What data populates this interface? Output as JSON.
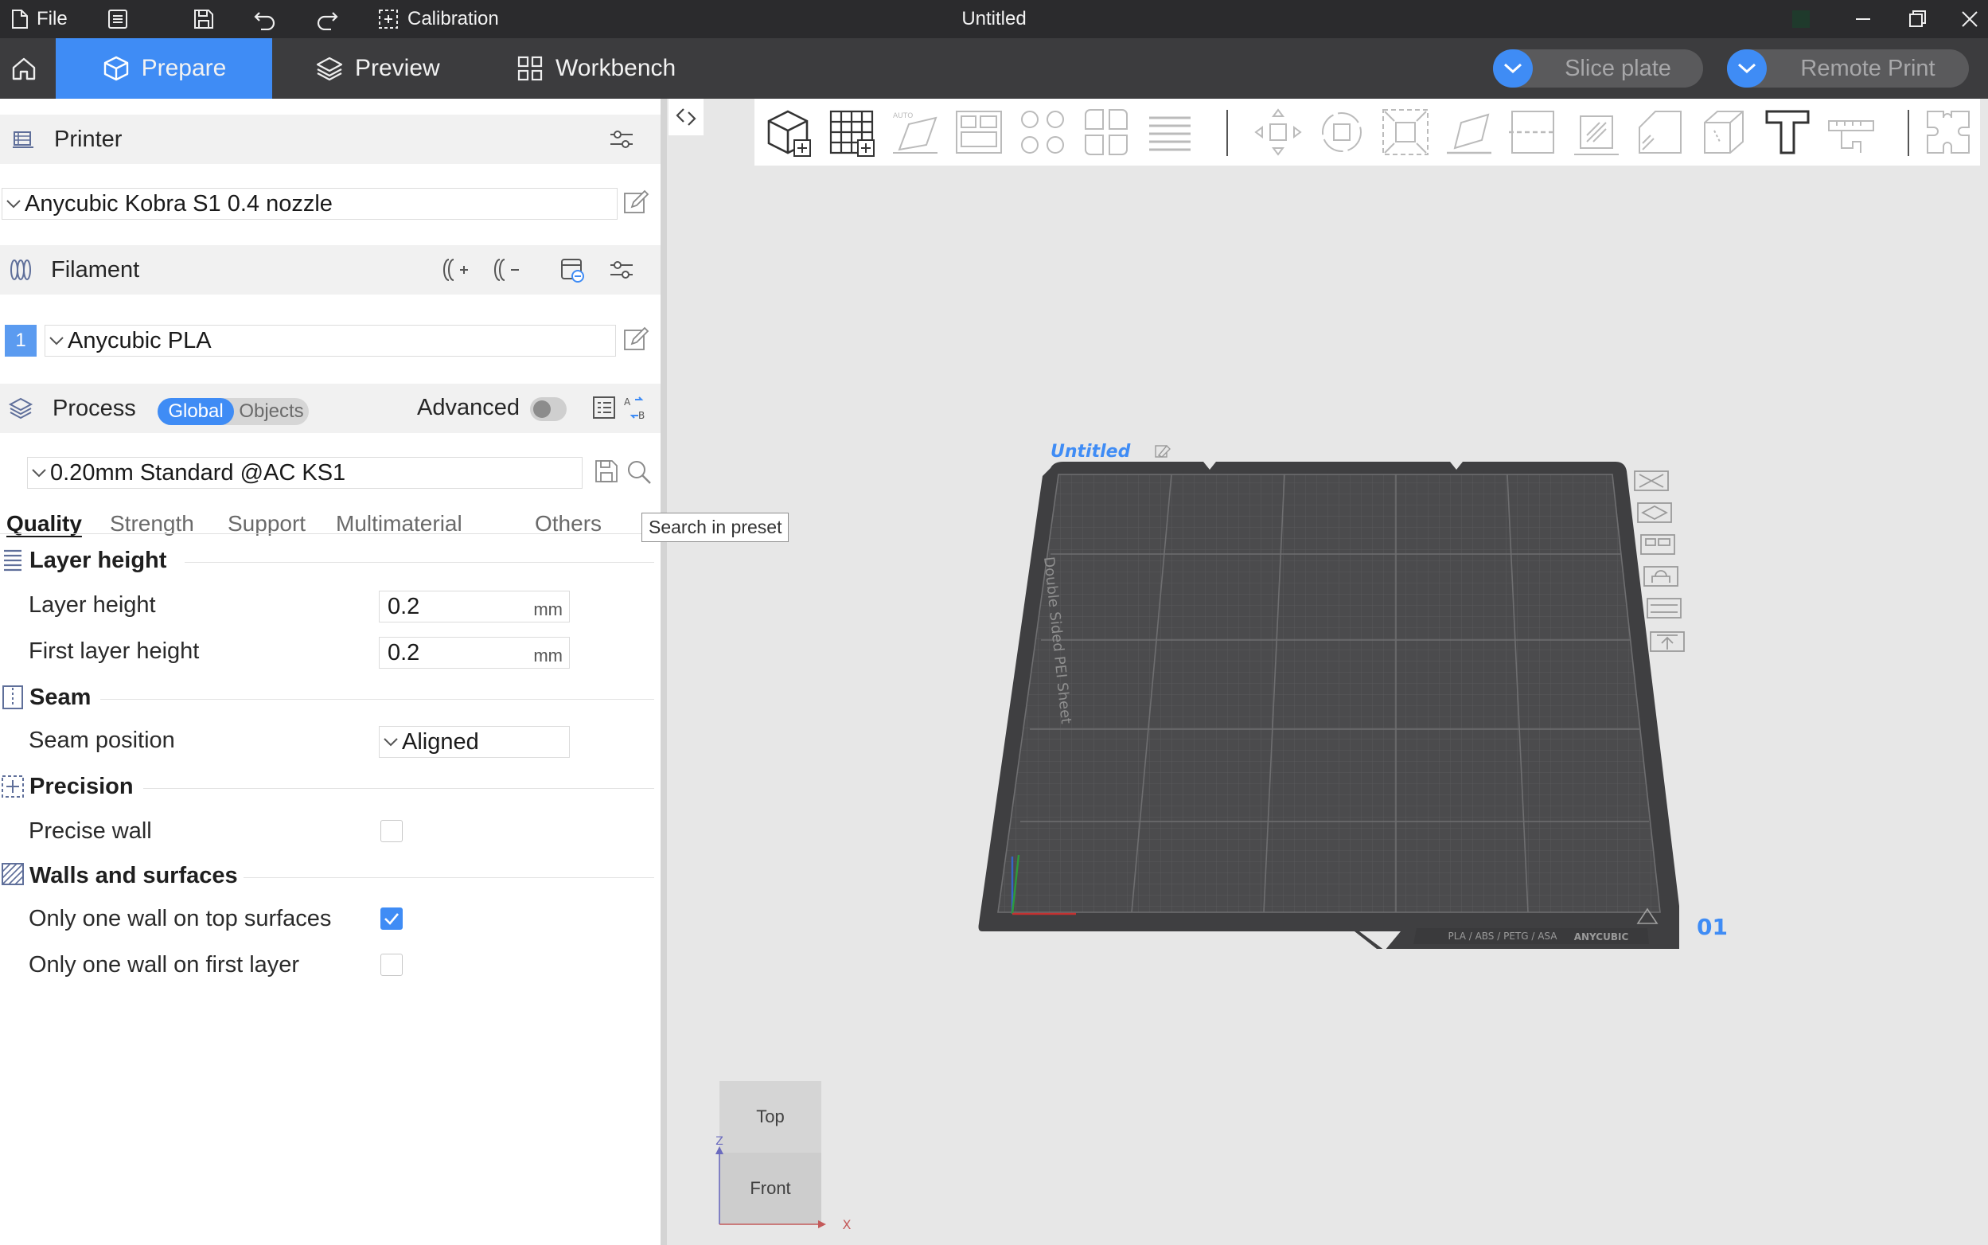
{
  "titlebar": {
    "file_label": "File",
    "calibration_label": "Calibration",
    "window_title": "Untitled"
  },
  "nav": {
    "tabs": [
      {
        "label": "Prepare",
        "active": true
      },
      {
        "label": "Preview",
        "active": false
      },
      {
        "label": "Workbench",
        "active": false
      }
    ],
    "slice_label": "Slice plate",
    "remote_label": "Remote Print"
  },
  "printer": {
    "section_title": "Printer",
    "selected": "Anycubic Kobra S1 0.4 nozzle"
  },
  "filament": {
    "section_title": "Filament",
    "slots": [
      {
        "index": "1",
        "name": "Anycubic PLA",
        "color": "#5b9bf0"
      }
    ]
  },
  "process": {
    "section_title": "Process",
    "toggle_global": "Global",
    "toggle_objects": "Objects",
    "advanced_label": "Advanced",
    "advanced_on": false,
    "preset": "0.20mm Standard @AC KS1",
    "tabs": [
      "Quality",
      "Strength",
      "Support",
      "Multimaterial",
      "Others"
    ],
    "active_tab": "Quality",
    "tooltip": "Search in preset",
    "groups": {
      "layer_height": {
        "title": "Layer height",
        "layer_height_label": "Layer height",
        "layer_height_value": "0.2",
        "first_layer_label": "First layer height",
        "first_layer_value": "0.2",
        "unit": "mm"
      },
      "seam": {
        "title": "Seam",
        "position_label": "Seam position",
        "position_value": "Aligned"
      },
      "precision": {
        "title": "Precision",
        "precise_wall_label": "Precise wall",
        "precise_wall": false
      },
      "walls": {
        "title": "Walls and surfaces",
        "one_wall_top_label": "Only one wall on top surfaces",
        "one_wall_top": true,
        "one_wall_first_label": "Only one wall on first layer",
        "one_wall_first": false
      }
    }
  },
  "plate": {
    "name": "Untitled",
    "number": "01",
    "sheet_label": "Double Sided PEI Sheet",
    "materials_label": "PLA / ABS / PETG / ASA",
    "brand_label": "ANYCUBIC"
  },
  "viewcube": {
    "top_label": "Top",
    "front_label": "Front",
    "x_axis": "X",
    "z_axis": "Z"
  },
  "colors": {
    "accent": "#3f8cf5",
    "titlebar": "#2b2b2d",
    "navbar": "#3c3c3e",
    "plate": "#4a4a4c"
  }
}
